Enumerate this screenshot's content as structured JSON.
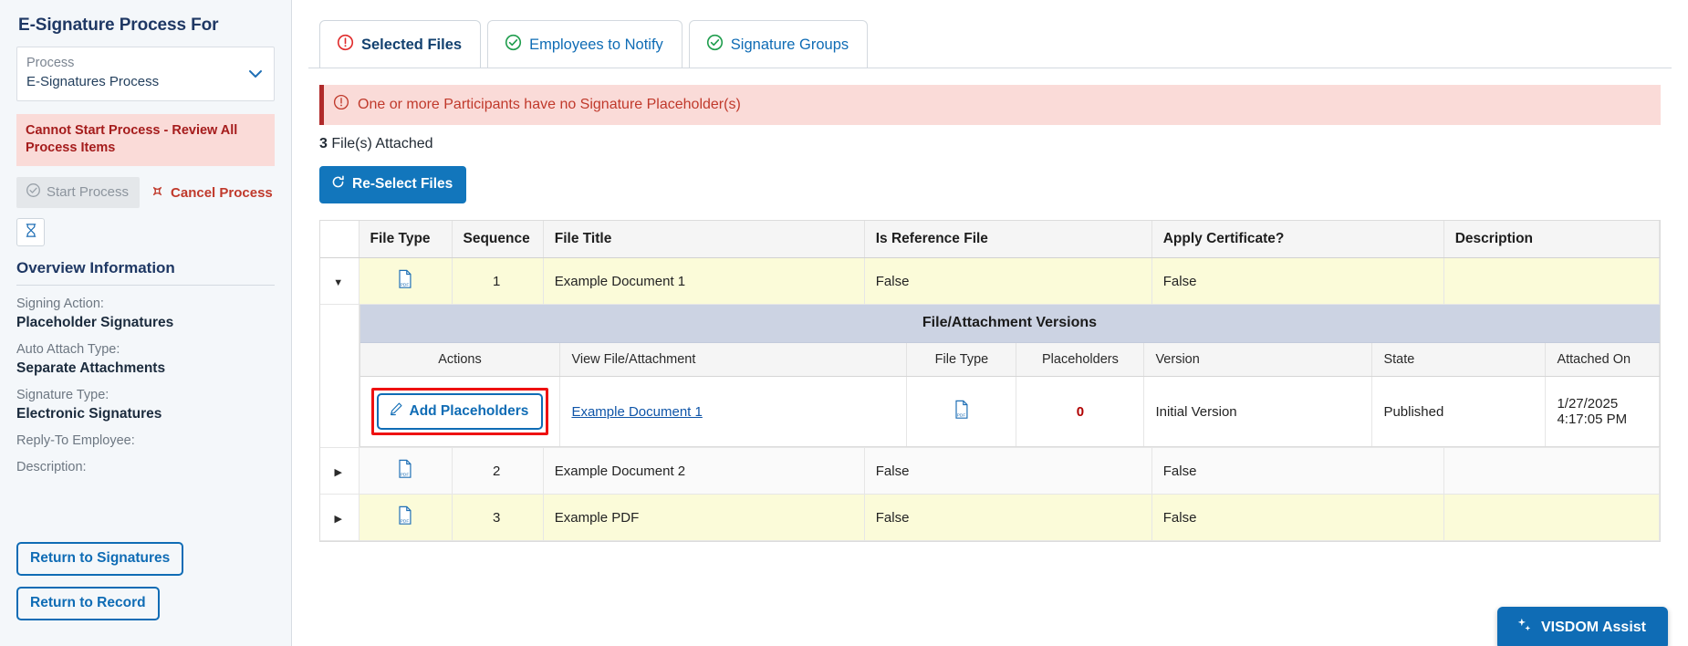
{
  "sidebar": {
    "title": "E-Signature Process For",
    "process_field": {
      "label": "Process",
      "value": "E-Signatures Process"
    },
    "alert": "Cannot Start Process - Review All Process Items",
    "start_process_label": "Start Process",
    "cancel_process_label": "Cancel Process",
    "overview_title": "Overview Information",
    "details": [
      {
        "label": "Signing Action:",
        "value": "Placeholder Signatures"
      },
      {
        "label": "Auto Attach Type:",
        "value": "Separate Attachments"
      },
      {
        "label": "Signature Type:",
        "value": "Electronic Signatures"
      },
      {
        "label": "Reply-To Employee:",
        "value": ""
      },
      {
        "label": "Description:",
        "value": ""
      }
    ],
    "return_to_signatures": "Return to Signatures",
    "return_to_record": "Return to Record"
  },
  "tabs": [
    {
      "label": "Selected Files",
      "icon": "warning-circle-icon",
      "status": "error",
      "active": true
    },
    {
      "label": "Employees to Notify",
      "icon": "check-circle-icon",
      "status": "ok",
      "active": false
    },
    {
      "label": "Signature Groups",
      "icon": "check-circle-icon",
      "status": "ok",
      "active": false
    }
  ],
  "alert_bar": {
    "text": "One or more Participants have no Signature Placeholder(s)",
    "icon": "warning-circle-icon"
  },
  "file_count": {
    "count": "3",
    "suffix": "File(s) Attached"
  },
  "reselect_button": {
    "label": "Re-Select Files",
    "icon": "refresh-icon"
  },
  "table": {
    "headers": [
      "",
      "File Type",
      "Sequence",
      "File Title",
      "Is Reference File",
      "Apply Certificate?",
      "Description"
    ],
    "rows": [
      {
        "expanded": true,
        "file_type": "pdf-file-icon",
        "sequence": "1",
        "title": "Example Document 1",
        "is_reference": "False",
        "apply_certificate": "False",
        "description": ""
      },
      {
        "expanded": false,
        "file_type": "pdf-file-icon",
        "sequence": "2",
        "title": "Example Document 2",
        "is_reference": "False",
        "apply_certificate": "False",
        "description": ""
      },
      {
        "expanded": false,
        "file_type": "pdf-file-icon",
        "sequence": "3",
        "title": "Example PDF",
        "is_reference": "False",
        "apply_certificate": "False",
        "description": ""
      }
    ]
  },
  "subtable": {
    "banner": "File/Attachment Versions",
    "headers": [
      "Actions",
      "View File/Attachment",
      "File Type",
      "Placeholders",
      "Version",
      "State",
      "Attached On"
    ],
    "rows": [
      {
        "action_label": "Add Placeholders",
        "action_icon": "pencil-icon",
        "view_link": "Example Document 1",
        "file_type": "pdf-file-icon",
        "placeholders": "0",
        "version": "Initial Version",
        "state": "Published",
        "attached_on": "1/27/2025 4:17:05 PM"
      }
    ]
  },
  "assist_button": {
    "label": "VISDOM Assist",
    "icon": "sparkle-icon"
  },
  "colors": {
    "accent_blue": "#0f6cb5",
    "error_red": "#c0392b",
    "alert_bg": "#fadbd8",
    "row_yellow": "#fbfbd9",
    "highlight_red": "#ee1111",
    "sub_banner": "#ccd3e3"
  }
}
